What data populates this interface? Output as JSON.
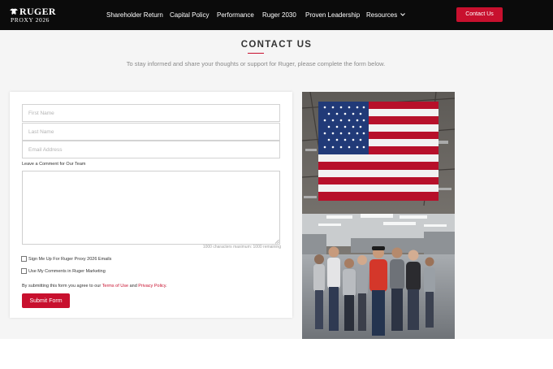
{
  "header": {
    "logo": {
      "brand": "RUGER",
      "subtitle": "PROXY 2026"
    },
    "nav": [
      {
        "label": "Shareholder Return"
      },
      {
        "label": "Capital Policy"
      },
      {
        "label": "Performance"
      },
      {
        "label": "Ruger 2030"
      },
      {
        "label": "Proven Leadership"
      },
      {
        "label": "Resources",
        "icon": "chevron-down-icon"
      }
    ],
    "cta_label": "Contact Us"
  },
  "page": {
    "title": "CONTACT US",
    "subtitle": "To stay informed and share your thoughts or support for Ruger, please complete the form below."
  },
  "form": {
    "first_name": {
      "placeholder": "First Name",
      "value": ""
    },
    "last_name": {
      "placeholder": "Last Name",
      "value": ""
    },
    "email": {
      "placeholder": "Email Address",
      "value": ""
    },
    "comment_label": "Leave a Comment for Our Team",
    "comment_value": "",
    "char_count": "1000 characters maximum: 1000 remaining",
    "checkboxes": [
      {
        "label": "Sign Me Up For Ruger Proxy 2026 Emails",
        "checked": false
      },
      {
        "label": "Use My Comments in Ruger Marketing",
        "checked": false
      }
    ],
    "terms": {
      "prefix": "By submitting this form you agree to our ",
      "terms_link": "Terms of Use",
      "middle": " and ",
      "privacy_link": "Privacy Policy",
      "suffix": "."
    },
    "submit_label": "Submit Form"
  },
  "colors": {
    "accent": "#c8102e",
    "nav_bg": "#0b0b0b",
    "page_bg": "#f5f5f5"
  }
}
